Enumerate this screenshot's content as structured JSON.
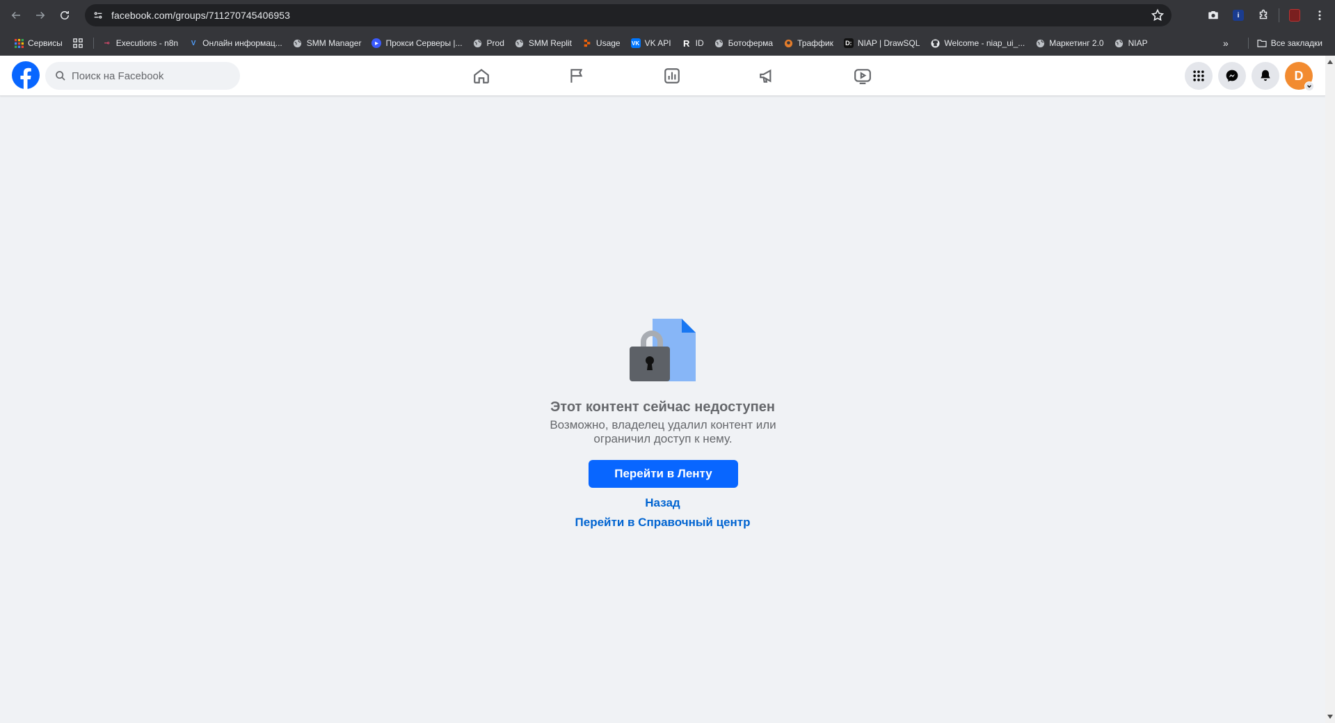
{
  "browser": {
    "url": "facebook.com/groups/711270745406953",
    "bookmarks": [
      {
        "label": "Сервисы",
        "icon": "apps-grid-icon",
        "color": "#e8eaed"
      },
      {
        "label": "Executions - n8n",
        "icon": "n8n-icon",
        "color": "#ea4b71"
      },
      {
        "label": "Онлайн информац...",
        "icon": "v-icon",
        "color": "#4f9cf9"
      },
      {
        "label": "SMM Manager",
        "icon": "globe-icon",
        "color": "#bdc1c6"
      },
      {
        "label": "Прокси Серверы |...",
        "icon": "proxy-icon",
        "color": "#3b5bff"
      },
      {
        "label": "Prod",
        "icon": "globe-icon",
        "color": "#bdc1c6"
      },
      {
        "label": "SMM Replit",
        "icon": "globe-icon",
        "color": "#bdc1c6"
      },
      {
        "label": "Usage",
        "icon": "replit-icon",
        "color": "#f26207"
      },
      {
        "label": "VK API",
        "icon": "vk-icon",
        "color": "#0077ff"
      },
      {
        "label": "ID",
        "icon": "r-icon",
        "color": "#ffffff"
      },
      {
        "label": "Ботоферма",
        "icon": "globe-icon",
        "color": "#bdc1c6"
      },
      {
        "label": "Траффик",
        "icon": "traffic-icon",
        "color": "#e37c2b"
      },
      {
        "label": "NIAP | DrawSQL",
        "icon": "drawsql-icon",
        "color": "#ffffff"
      },
      {
        "label": "Welcome - niap_ui_...",
        "icon": "github-icon",
        "color": "#e8eaed"
      },
      {
        "label": "Маркетинг 2.0",
        "icon": "globe-icon",
        "color": "#bdc1c6"
      },
      {
        "label": "NIAP",
        "icon": "globe-icon",
        "color": "#bdc1c6"
      }
    ],
    "all_bookmarks": "Все закладки",
    "more": "»"
  },
  "facebook": {
    "search_placeholder": "Поиск на Facebook",
    "avatar_initial": "D",
    "brand_color": "#0866ff"
  },
  "error": {
    "title": "Этот контент сейчас недоступен",
    "subtitle": "Возможно, владелец удалил контент или ограничил доступ к нему.",
    "primary_button": "Перейти в Ленту",
    "back_link": "Назад",
    "help_link": "Перейти в Справочный центр"
  }
}
